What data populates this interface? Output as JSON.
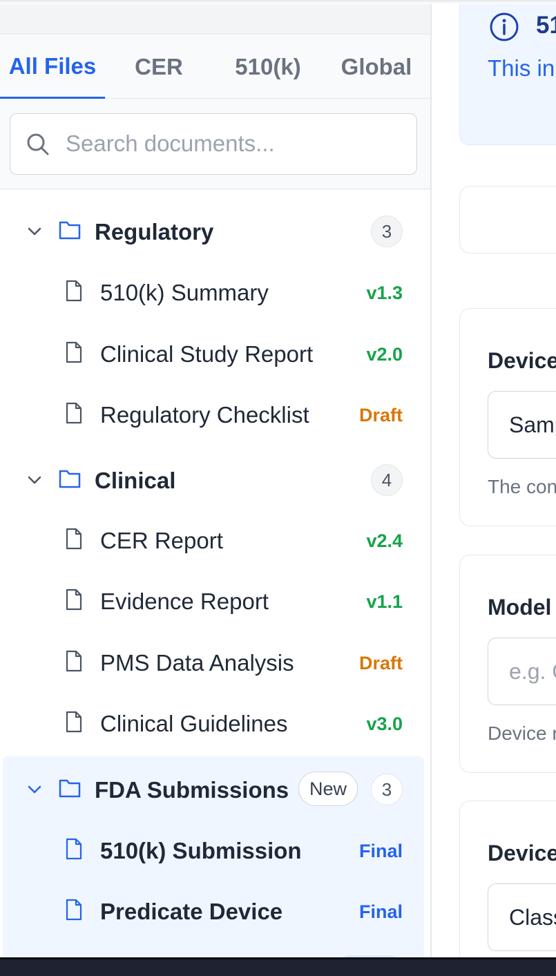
{
  "tabs": [
    {
      "label": "All Files",
      "active": true
    },
    {
      "label": "CER",
      "active": false
    },
    {
      "label": "510(k)",
      "active": false
    },
    {
      "label": "Global",
      "active": false
    }
  ],
  "search": {
    "placeholder": "Search documents..."
  },
  "folders": [
    {
      "name": "Regulatory",
      "count": "3",
      "files": [
        {
          "name": "510(k) Summary",
          "status": "v1.3",
          "status_color": "#16a34a"
        },
        {
          "name": "Clinical Study Report",
          "status": "v2.0",
          "status_color": "#16a34a"
        },
        {
          "name": "Regulatory Checklist",
          "status": "Draft",
          "status_color": "#d97706"
        }
      ]
    },
    {
      "name": "Clinical",
      "count": "4",
      "files": [
        {
          "name": "CER Report",
          "status": "v2.4",
          "status_color": "#16a34a"
        },
        {
          "name": "Evidence Report",
          "status": "v1.1",
          "status_color": "#16a34a"
        },
        {
          "name": "PMS Data Analysis",
          "status": "Draft",
          "status_color": "#d97706"
        },
        {
          "name": "Clinical Guidelines",
          "status": "v3.0",
          "status_color": "#16a34a"
        }
      ]
    },
    {
      "name": "FDA Submissions",
      "count": "3",
      "badge": "New",
      "selected": true,
      "files": [
        {
          "name": "510(k) Submission",
          "status": "Final",
          "status_color": "#2563eb"
        },
        {
          "name": "Predicate Device",
          "status": "Final",
          "status_color": "#2563eb"
        }
      ]
    }
  ],
  "main": {
    "info_title": "51",
    "info_text": "This in predica",
    "cards": [
      {
        "label": "Device",
        "value": "Samp",
        "help": "The con"
      },
      {
        "label": "Model",
        "placeholder": "e.g. C",
        "help": "Device r"
      },
      {
        "label": "Device",
        "value": "Class"
      }
    ]
  },
  "colors": {
    "accent": "#2563eb",
    "success": "#16a34a",
    "warning": "#d97706"
  },
  "icons": [
    "search-icon",
    "chevron-down-icon",
    "folder-icon",
    "document-icon",
    "info-icon"
  ]
}
